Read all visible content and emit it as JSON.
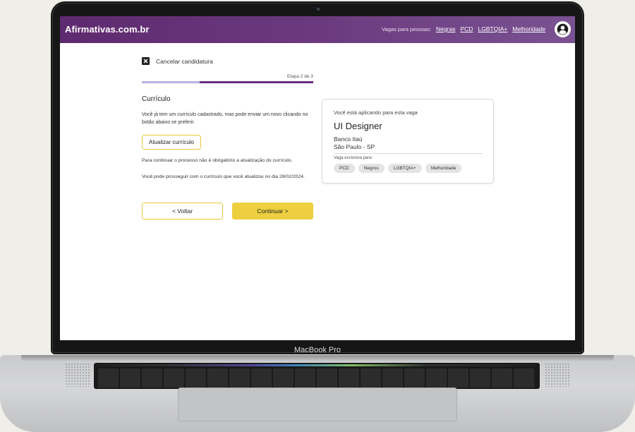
{
  "device": {
    "brand": "MacBook Pro"
  },
  "app": {
    "logo": "Afirmativas.com.br",
    "nav_label": "Vagas para pessoas:",
    "nav_links": [
      "Negras",
      "PCD",
      "LGBTQIA+",
      "Melhoridade"
    ]
  },
  "form": {
    "cancel_label": "Cancelar candidatura",
    "step_label": "Etapa 2 de 3",
    "progress_fraction": 0.667,
    "section_title": "Currículo",
    "description": "Você já tem um currículo cadastrado, mas pode enviar um novo clicando no botão abaixo se preferir.",
    "update_button": "Atualizar currículo",
    "note": "Para continuar o processo não é obrigatório a  atualização do currículo.",
    "last_update": "Você pode prosseguir com o currículo que você atualizou no dia 28/02/2024.",
    "back_button": "< Voltar",
    "next_button": "Continuar >"
  },
  "job_card": {
    "label": "Você está aplicando para esta vaga",
    "job_title": "UI Designer",
    "company": "Banco Itaú",
    "location": "São Paulo - SP",
    "exclusive_label": "Vaga exclusiva para:",
    "tags": [
      "PCD",
      "Negros",
      "LGBTQIA+",
      "Melhoridade"
    ]
  },
  "colors": {
    "header": "#6b3a7e",
    "accent_yellow": "#edcf3f",
    "progress_done": "#b7b1e2",
    "progress_current": "#6a2e7d"
  },
  "icons": {
    "cancel": "close-square-icon",
    "user": "user-avatar-icon",
    "camera": "webcam-icon"
  }
}
